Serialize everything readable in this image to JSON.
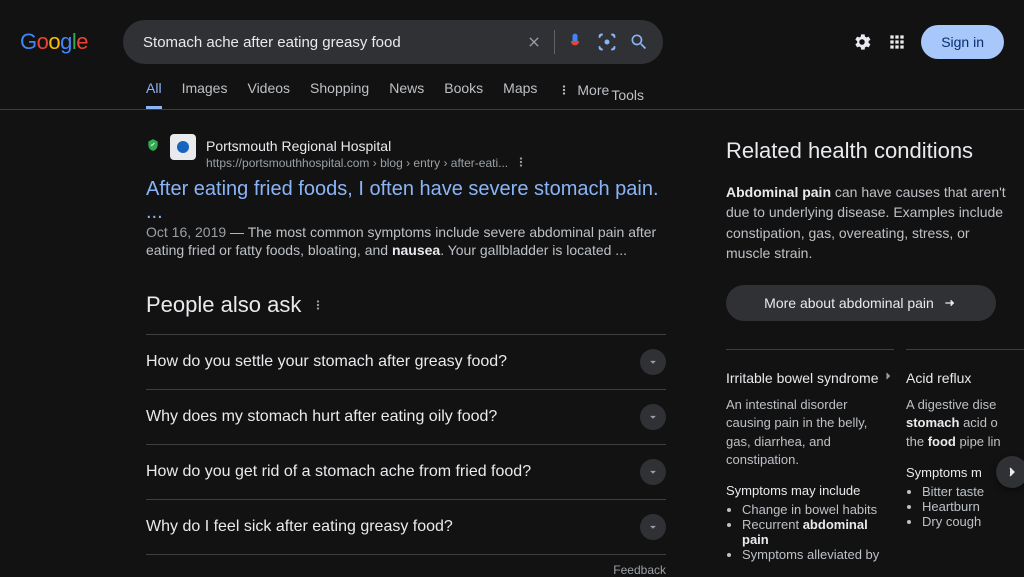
{
  "search": {
    "query": "Stomach ache after eating greasy food"
  },
  "tabs": {
    "all": "All",
    "images": "Images",
    "videos": "Videos",
    "shopping": "Shopping",
    "news": "News",
    "books": "Books",
    "maps": "Maps",
    "more": "More",
    "tools": "Tools"
  },
  "header": {
    "signin": "Sign in"
  },
  "result": {
    "source": "Portsmouth Regional Hospital",
    "url": "https://portsmouthhospital.com › blog › entry › after-eati...",
    "title": "After eating fried foods, I often have severe stomach pain. ...",
    "date": "Oct 16, 2019",
    "snippet_pre": " — The most common symptoms include severe abdominal pain after eating fried or fatty foods, bloating, and ",
    "snippet_bold": "nausea",
    "snippet_post": ". Your gallbladder is located ..."
  },
  "paa": {
    "title": "People also ask",
    "items": [
      "How do you settle your stomach after greasy food?",
      "Why does my stomach hurt after eating oily food?",
      "How do you get rid of a stomach ache from fried food?",
      "Why do I feel sick after eating greasy food?"
    ],
    "feedback": "Feedback"
  },
  "kp": {
    "title": "Related health conditions",
    "desc_bold": "Abdominal pain",
    "desc_rest": " can have causes that aren't due to underlying disease. Examples include constipation, gas, overeating, stress, or muscle strain.",
    "more": "More about abdominal pain"
  },
  "cards": [
    {
      "title": "Irritable bowel syndrome",
      "desc": "An intestinal disorder causing pain in the belly, gas, diarrhea, and constipation.",
      "sub": "Symptoms may include",
      "symptoms": [
        "Change in bowel habits",
        "Recurrent <b>abdominal pain</b>",
        "Symptoms alleviated by"
      ]
    },
    {
      "title": "Acid reflux",
      "desc": "A digestive dise<br><b>stomach</b> acid o<br>the <b>food</b> pipe lin",
      "sub": "Symptoms m",
      "symptoms": [
        "Bitter taste",
        "Heartburn",
        "Dry cough"
      ]
    }
  ]
}
